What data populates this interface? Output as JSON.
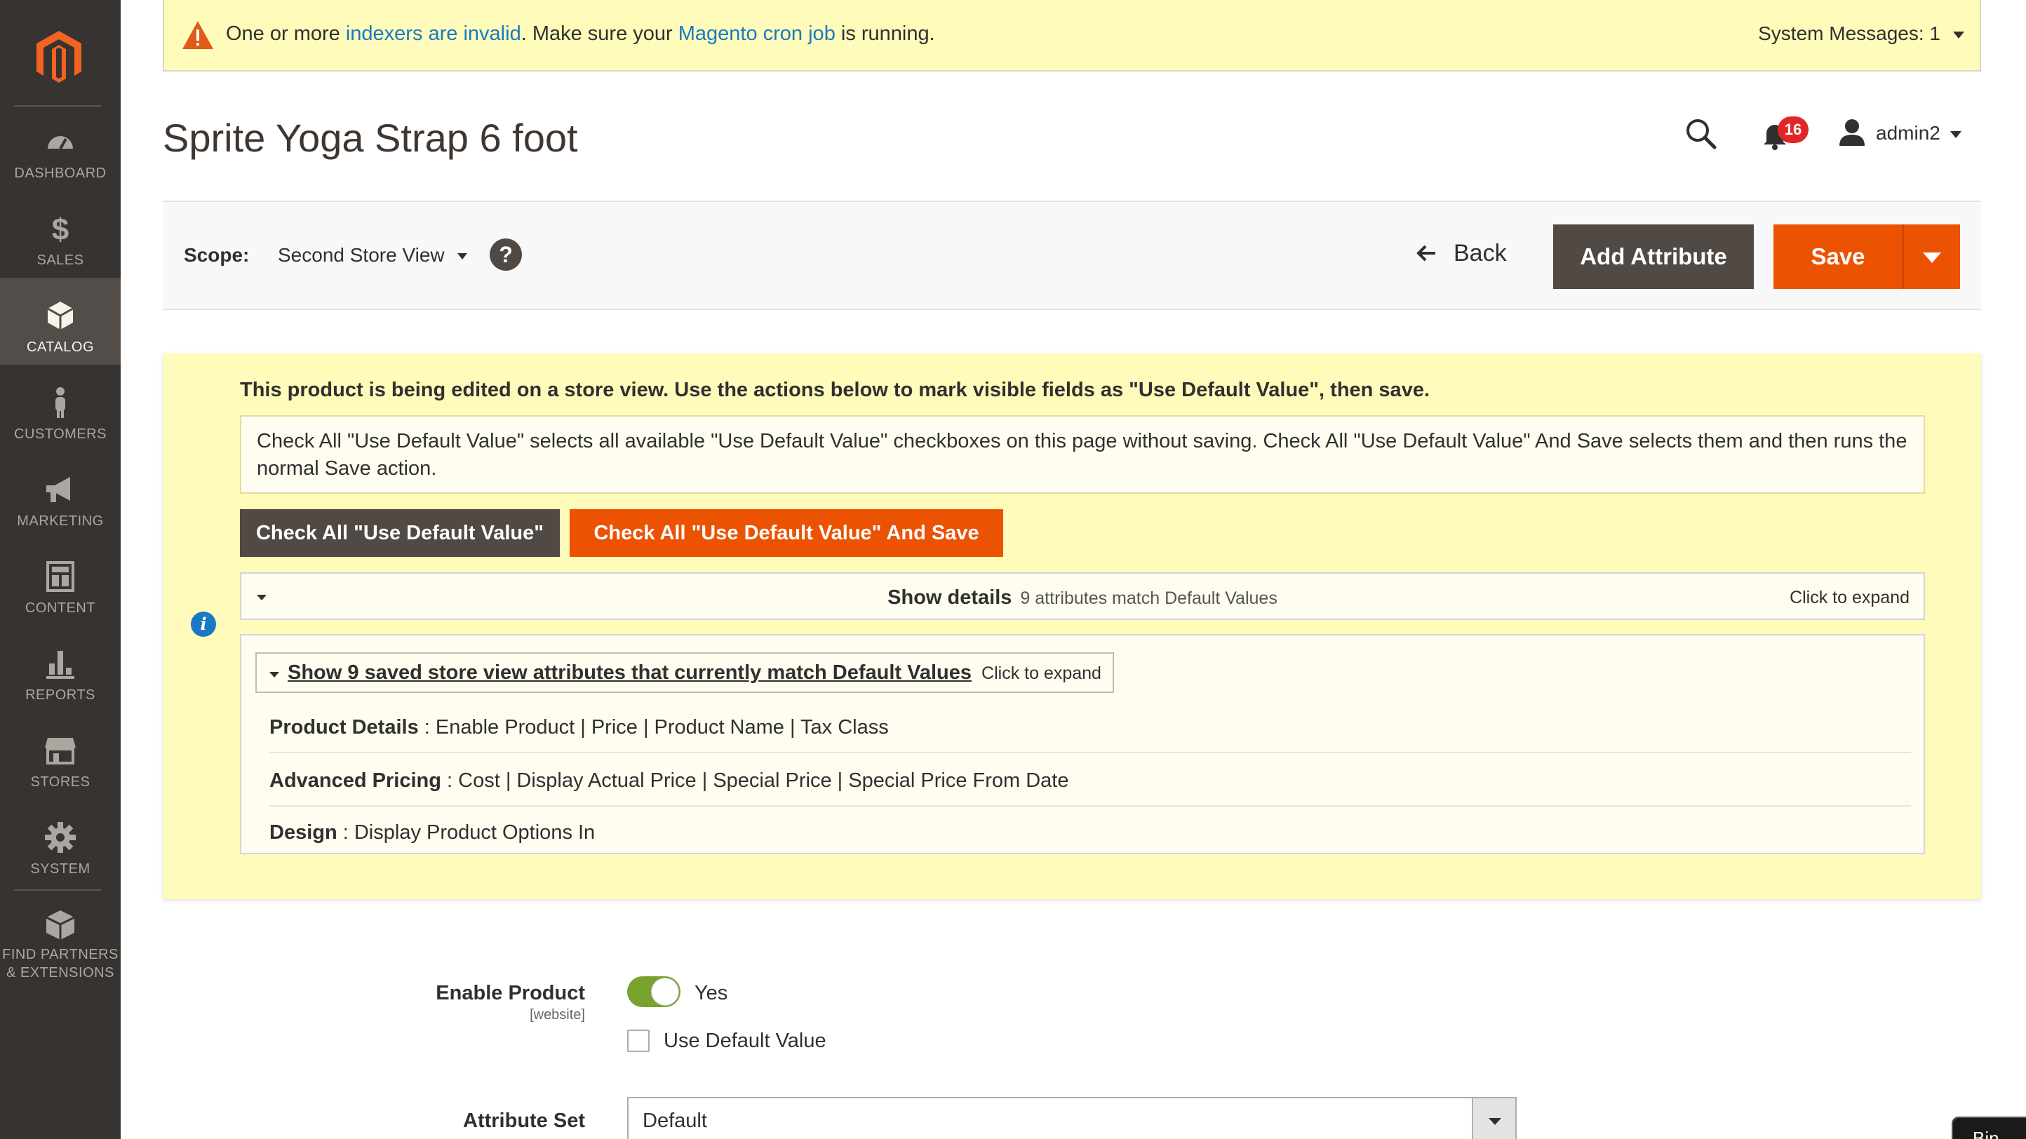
{
  "sidebar": {
    "items": [
      {
        "label": "DASHBOARD",
        "icon": "dashboard-icon"
      },
      {
        "label": "SALES",
        "icon": "dollar-icon"
      },
      {
        "label": "CATALOG",
        "icon": "cube-icon",
        "active": true
      },
      {
        "label": "CUSTOMERS",
        "icon": "person-icon"
      },
      {
        "label": "MARKETING",
        "icon": "megaphone-icon"
      },
      {
        "label": "CONTENT",
        "icon": "layout-icon"
      },
      {
        "label": "REPORTS",
        "icon": "bar-chart-icon"
      },
      {
        "label": "STORES",
        "icon": "storefront-icon"
      },
      {
        "label": "SYSTEM",
        "icon": "gear-icon"
      },
      {
        "label_line1": "FIND PARTNERS",
        "label_line2": "& EXTENSIONS",
        "icon": "boxes-icon"
      }
    ]
  },
  "system_message": {
    "prefix": "One or more ",
    "link1": "indexers are invalid",
    "middle": ". Make sure your ",
    "link2": "Magento cron job",
    "suffix": " is running.",
    "counter": "System Messages: 1"
  },
  "header": {
    "title": "Sprite Yoga Strap 6 foot",
    "notification_count": "16",
    "user": "admin2"
  },
  "actions": {
    "scope_label": "Scope:",
    "scope_value": "Second Store View",
    "help": "?",
    "back": "Back",
    "add_attribute": "Add Attribute",
    "save": "Save"
  },
  "notice": {
    "heading": "This product is being edited on a store view. Use the actions below to mark visible fields as \"Use Default Value\", then save.",
    "description": "Check All \"Use Default Value\" selects all available \"Use Default Value\" checkboxes on this page without saving. Check All \"Use Default Value\" And Save selects them and then runs the normal Save action.",
    "btn_check_all": "Check All \"Use Default Value\"",
    "btn_check_all_save": "Check All \"Use Default Value\" And Save",
    "details_title": "Show details",
    "details_count": "9 attributes match Default Values",
    "details_expand": "Click to expand",
    "saved_title": "Show 9 saved store view attributes that currently match Default Values",
    "saved_expand": "Click to expand",
    "groups": [
      {
        "name": "Product Details",
        "attrs": " : Enable Product | Price | Product Name | Tax Class"
      },
      {
        "name": "Advanced Pricing",
        "attrs": " : Cost | Display Actual Price | Special Price | Special Price From Date"
      },
      {
        "name": "Design",
        "attrs": " : Display Product Options In"
      }
    ]
  },
  "form": {
    "enable_label": "Enable Product",
    "enable_scope": "[website]",
    "enable_value": "Yes",
    "use_default": "Use Default Value",
    "attribute_set_label": "Attribute Set",
    "attribute_set_value": "Default"
  },
  "corner_button": "Bin",
  "colors": {
    "sidebar": "#373330",
    "accent": "#eb5202",
    "dark_button": "#514943",
    "notice_bg": "#fffbbb",
    "link": "#1979c3",
    "toggle_on": "#79a22e"
  }
}
